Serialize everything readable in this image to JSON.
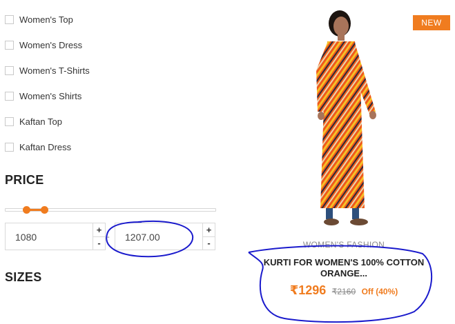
{
  "filters": {
    "categories": [
      {
        "label": "Women's Top",
        "checked": false
      },
      {
        "label": "Women's Dress",
        "checked": false
      },
      {
        "label": "Women's T-Shirts",
        "checked": false
      },
      {
        "label": "Women's Shirts",
        "checked": false
      },
      {
        "label": "Kaftan Top",
        "checked": false
      },
      {
        "label": "Kaftan Dress",
        "checked": false
      }
    ],
    "price": {
      "heading": "PRICE",
      "min_value": "1080",
      "max_value": "1207.00",
      "plus": "+",
      "minus": "-",
      "dash": "-"
    },
    "sizes_heading": "SIZES"
  },
  "product": {
    "badge": "NEW",
    "brand": "WOMEN'S FASHION",
    "title": "KURTI FOR WOMEN'S 100% COTTON ORANGE...",
    "sale_price": "₹1296",
    "mrp": "₹2160",
    "discount": "Off (40%)"
  },
  "colors": {
    "accent": "#f07c1f",
    "annotation": "#1a1acc"
  }
}
